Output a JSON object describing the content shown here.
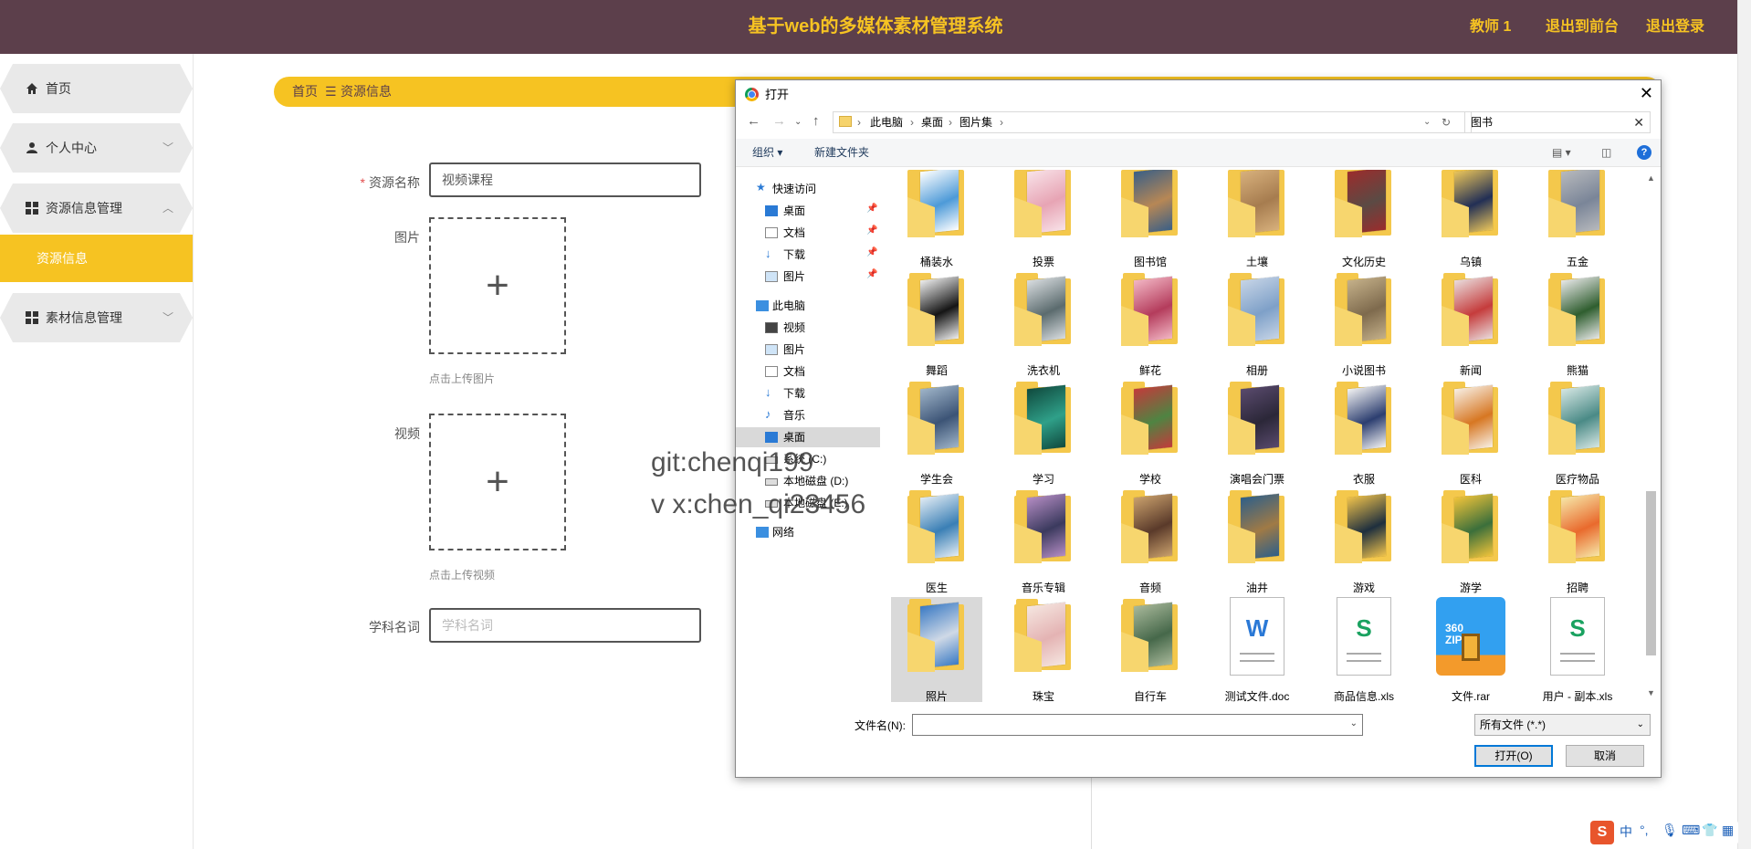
{
  "header": {
    "title": "基于web的多媒体素材管理系统",
    "user": "教师 1",
    "back_front": "退出到前台",
    "logout": "退出登录"
  },
  "sidebar": {
    "items": [
      {
        "label": "首页",
        "icon": "home-icon"
      },
      {
        "label": "个人中心",
        "icon": "person-icon"
      },
      {
        "label": "资源信息管理",
        "icon": "grid-icon"
      },
      {
        "label": "素材信息管理",
        "icon": "grid-icon"
      }
    ],
    "sub_item": "资源信息"
  },
  "breadcrumb": {
    "home": "首页",
    "sep": "☰",
    "current": "资源信息"
  },
  "form": {
    "name_label": "资源名称",
    "name_value": "视频课程",
    "image_label": "图片",
    "image_hint": "点击上传图片",
    "video_label": "视频",
    "video_hint": "点击上传视频",
    "subject_label": "学科名词",
    "subject_placeholder": "学科名词"
  },
  "dialog": {
    "title": "打开",
    "path": [
      "此电脑",
      "桌面",
      "图片集"
    ],
    "search_value": "图书",
    "toolbar": {
      "organize": "组织 ▾",
      "new_folder": "新建文件夹"
    },
    "nav": {
      "quick_access": "快速访问",
      "quick": [
        "桌面",
        "文档",
        "下载",
        "图片"
      ],
      "this_pc": "此电脑",
      "pc": [
        "视频",
        "图片",
        "文档",
        "下载",
        "音乐",
        "桌面",
        "系统 (C:)",
        "本地磁盘 (D:)",
        "本地磁盘 (E:)"
      ],
      "network": "网络"
    },
    "files": [
      "桶装水",
      "投票",
      "图书馆",
      "土壤",
      "文化历史",
      "乌镇",
      "五金",
      "舞蹈",
      "洗衣机",
      "鲜花",
      "相册",
      "小说图书",
      "新闻",
      "熊猫",
      "学生会",
      "学习",
      "学校",
      "演唱会门票",
      "衣服",
      "医科",
      "医疗物品",
      "医生",
      "音乐专辑",
      "音频",
      "油井",
      "游戏",
      "游学",
      "招聘",
      "照片",
      "珠宝",
      "自行车",
      "测试文件.doc",
      "商品信息.xls",
      "文件.rar",
      "用户 - 副本.xls"
    ],
    "filename_label": "文件名(N):",
    "filename_value": "",
    "filetype": "所有文件 (*.*)",
    "open_button": "打开(O)",
    "cancel_button": "取消"
  },
  "watermark": {
    "line1": "git:chenqi199",
    "line2": "v x:chen_qi23456"
  },
  "ime": {
    "logo": "S",
    "mode": "中"
  }
}
